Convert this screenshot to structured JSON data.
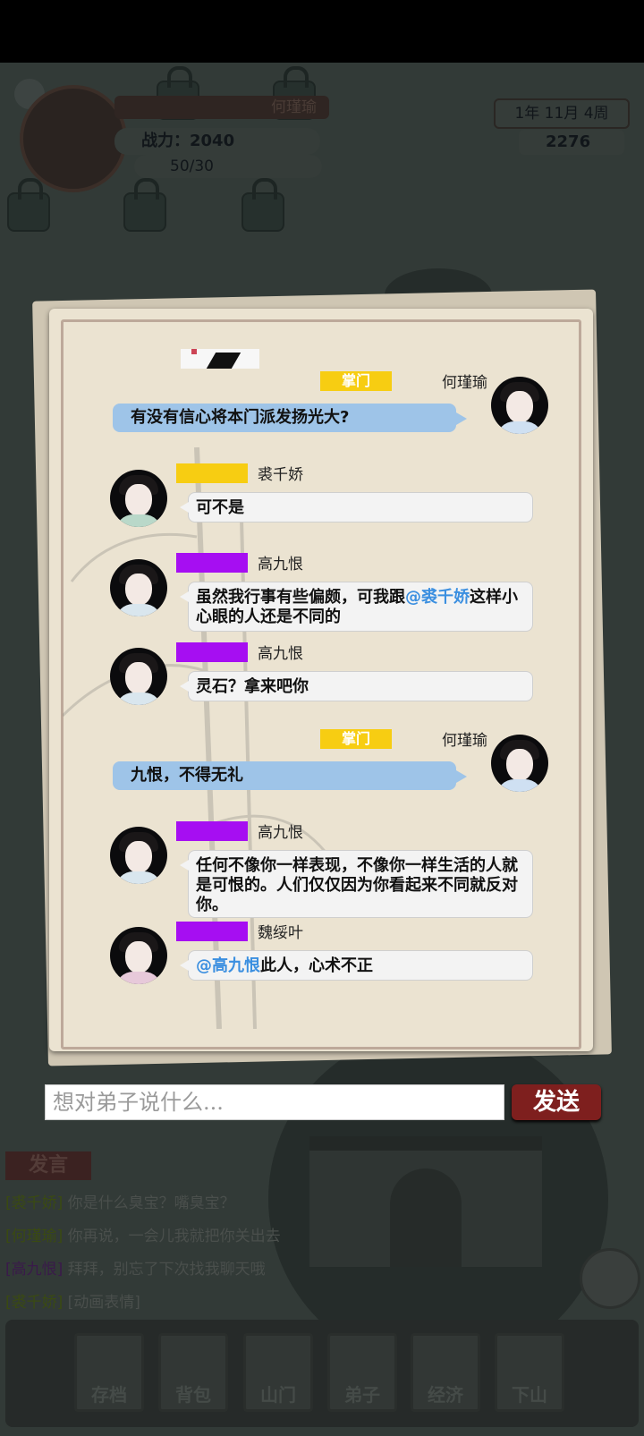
{
  "hud": {
    "player_name": "何瑾瑜",
    "power": "战力：2040",
    "stamina": "50/30",
    "date": "1年 11月  4周",
    "spirit_stones": "2276"
  },
  "chat": {
    "messages": [
      {
        "sender": "何瑾瑜",
        "rank": "掌门",
        "text": "有没有信心将本门派发扬光大?",
        "side": "right"
      },
      {
        "sender": "裘千娇",
        "rank": "",
        "text": "可不是",
        "side": "left"
      },
      {
        "sender": "高九恨",
        "rank": "",
        "text_before": "虽然我行事有些偏颇，可我跟",
        "mention": "@裘千娇",
        "text_after": "这样小心眼的人还是不同的",
        "side": "left"
      },
      {
        "sender": "高九恨",
        "rank": "",
        "text": "灵石？拿来吧你",
        "side": "left"
      },
      {
        "sender": "何瑾瑜",
        "rank": "掌门",
        "text": "九恨，不得无礼",
        "side": "right"
      },
      {
        "sender": "高九恨",
        "rank": "",
        "text": "任何不像你一样表现，不像你一样生活的人就是可恨的。人们仅仅因为你看起来不同就反对你。",
        "side": "left"
      },
      {
        "sender": "魏绥叶",
        "rank": "",
        "mention": "@高九恨",
        "text_after": "此人，心术不正",
        "side": "left"
      }
    ],
    "input_placeholder": "想对弟子说什么...",
    "send_label": "发送"
  },
  "background_log": {
    "title": "发言",
    "lines": [
      {
        "who": "[裘千娇]",
        "text": "你是什么臭宝？嘴臭宝？"
      },
      {
        "who": "[何瑾瑜]",
        "text": "你再说，一会儿我就把你关出去"
      },
      {
        "who": "[高九恨]",
        "text": "拜拜，别忘了下次找我聊天哦"
      },
      {
        "who": "[裘千娇]",
        "text": "[动画表情]"
      }
    ]
  },
  "bottom_nav": [
    "存档",
    "背包",
    "山门",
    "弟子",
    "经济",
    "下山"
  ],
  "colors": {
    "rank_gold": "#f7cd12",
    "rank_purple": "#a60ef2",
    "bubble_blue": "#9ec4e8",
    "mention": "#3b8fe0",
    "send_button": "#7e1f1e"
  }
}
